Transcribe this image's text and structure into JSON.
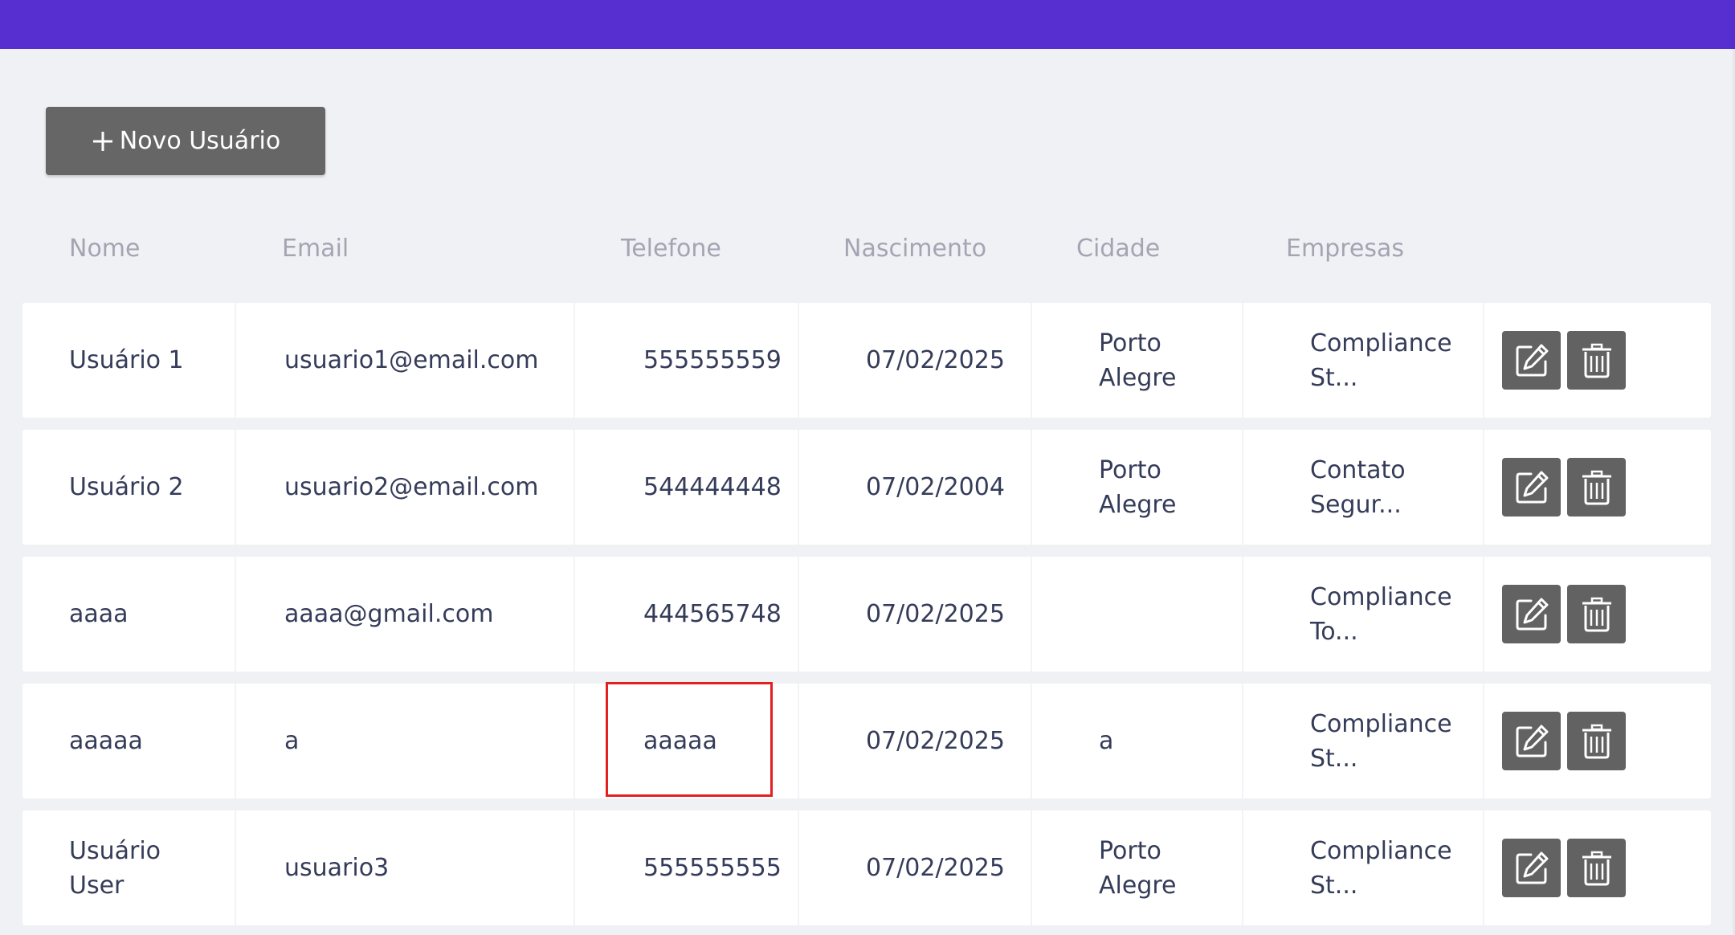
{
  "actions": {
    "new_user_label": "Novo Usuário"
  },
  "table": {
    "headers": {
      "nome": "Nome",
      "email": "Email",
      "telefone": "Telefone",
      "nascimento": "Nascimento",
      "cidade": "Cidade",
      "empresas": "Empresas"
    },
    "rows": [
      {
        "nome": [
          "Usuário 1"
        ],
        "email": "usuario1@email.com",
        "telefone": "555555559",
        "nascimento": "07/02/2025",
        "cidade": [
          "Porto",
          "Alegre"
        ],
        "empresas": [
          "Compliance",
          "St..."
        ]
      },
      {
        "nome": [
          "Usuário 2"
        ],
        "email": "usuario2@email.com",
        "telefone": "544444448",
        "nascimento": "07/02/2004",
        "cidade": [
          "Porto",
          "Alegre"
        ],
        "empresas": [
          "Contato",
          "Segur..."
        ]
      },
      {
        "nome": [
          "aaaa"
        ],
        "email": "aaaa@gmail.com",
        "telefone": "444565748",
        "nascimento": "07/02/2025",
        "cidade": [],
        "empresas": [
          "Compliance",
          "To..."
        ]
      },
      {
        "nome": [
          "aaaaa"
        ],
        "email": "a",
        "telefone": "aaaaa",
        "nascimento": "07/02/2025",
        "cidade": [
          "a"
        ],
        "empresas": [
          "Compliance",
          "St..."
        ]
      },
      {
        "nome": [
          "Usuário",
          "User"
        ],
        "email": "usuario3",
        "telefone": "555555555",
        "nascimento": "07/02/2025",
        "cidade": [
          "Porto",
          "Alegre"
        ],
        "empresas": [
          "Compliance",
          "St..."
        ]
      }
    ]
  },
  "icons": {
    "new_user": "plus-icon",
    "edit": "edit-icon",
    "delete": "trash-icon"
  },
  "colors": {
    "header_bar": "#572ed0",
    "button_bg": "#666666",
    "action_bg": "#626262",
    "highlight": "#e32020"
  }
}
